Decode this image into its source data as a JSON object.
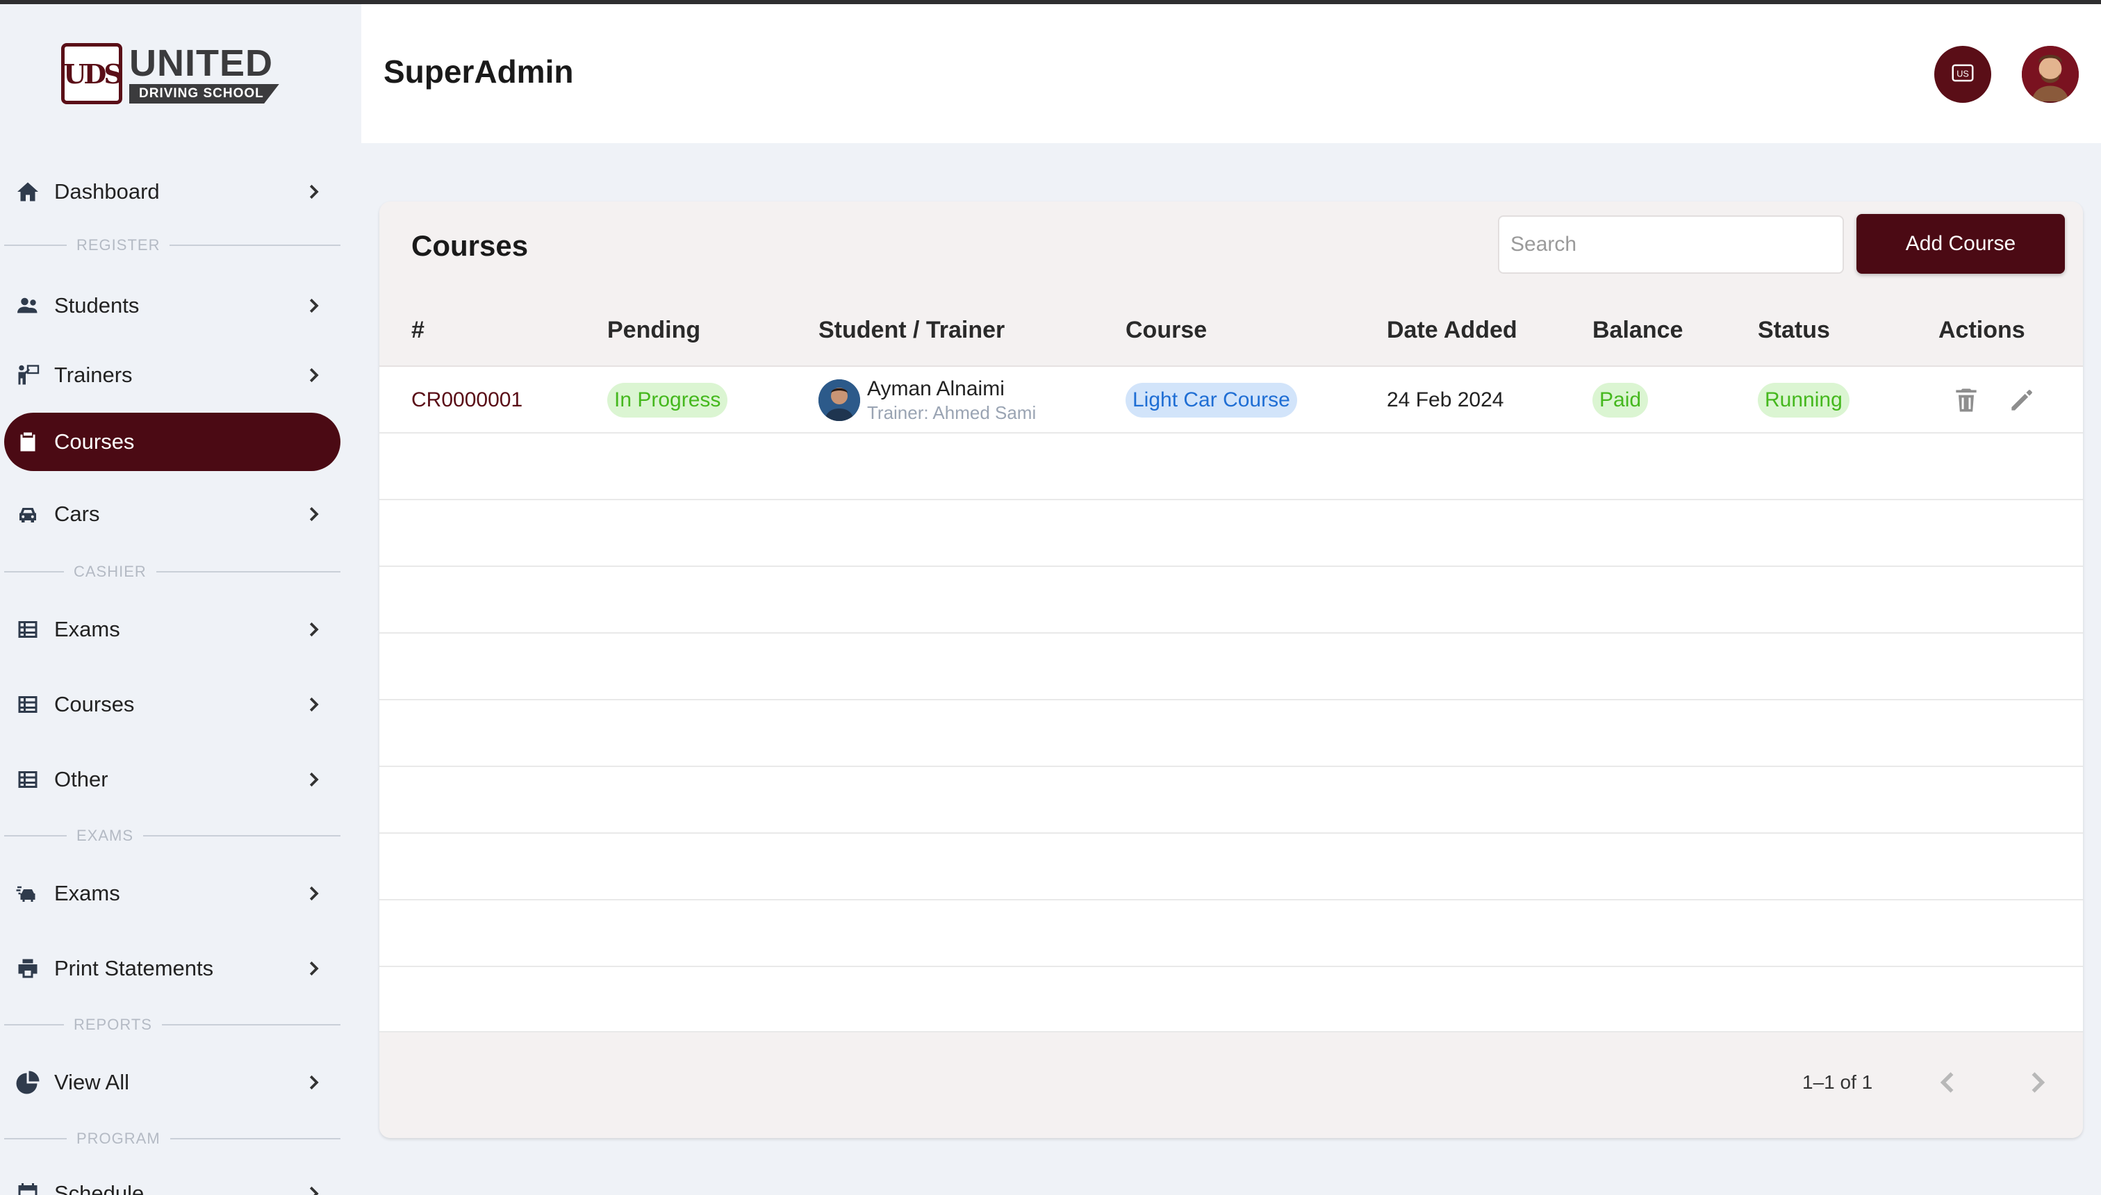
{
  "brand": {
    "logo_title": "UNITED",
    "logo_sub": "DRIVING SCHOOL"
  },
  "header": {
    "title": "SuperAdmin",
    "lang_icon": "language-flag-icon",
    "avatar_icon": "user-avatar-icon"
  },
  "sidebar": {
    "items": [
      {
        "label": "Dashboard",
        "icon": "home-icon"
      },
      {
        "label": "Students",
        "icon": "users-icon"
      },
      {
        "label": "Trainers",
        "icon": "trainer-icon"
      },
      {
        "label": "Courses",
        "icon": "clipboard-icon"
      },
      {
        "label": "Cars",
        "icon": "car-icon"
      },
      {
        "label": "Exams",
        "icon": "table-icon"
      },
      {
        "label": "Courses",
        "icon": "table-icon"
      },
      {
        "label": "Other",
        "icon": "table-icon"
      },
      {
        "label": "Exams",
        "icon": "exam-car-icon"
      },
      {
        "label": "Print Statements",
        "icon": "printer-icon"
      },
      {
        "label": "View All",
        "icon": "pie-chart-icon"
      },
      {
        "label": "Schedule",
        "icon": "calendar-icon"
      }
    ],
    "sections": [
      "REGISTER",
      "CASHIER",
      "EXAMS",
      "REPORTS",
      "PROGRAM"
    ],
    "active_index": 3
  },
  "card": {
    "title": "Courses",
    "search_placeholder": "Search",
    "add_label": "Add Course"
  },
  "table": {
    "columns": [
      "#",
      "Pending",
      "Student / Trainer",
      "Course",
      "Date Added",
      "Balance",
      "Status",
      "Actions"
    ],
    "rows": [
      {
        "code": "CR0000001",
        "pending": "In Progress",
        "student": "Ayman Alnaimi",
        "trainer": "Trainer: Ahmed Sami",
        "course": "Light Car Course",
        "date": "24 Feb 2024",
        "balance": "Paid",
        "status": "Running"
      }
    ]
  },
  "pagination": {
    "text": "1–1 of 1"
  },
  "colors": {
    "brand": "#4b0a14",
    "success": "#45b81e",
    "info": "#1f6ed4"
  }
}
